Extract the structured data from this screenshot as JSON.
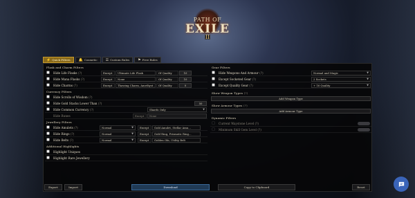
{
  "logo": {
    "line1": "PATH OF",
    "line2": "EXILE",
    "numeral": "II"
  },
  "tabs": [
    {
      "label": "Quick Filters",
      "icon": "lightning-icon"
    },
    {
      "label": "Cosmetic",
      "icon": "bell-icon"
    },
    {
      "label": "Custom Rules",
      "icon": "list-icon"
    },
    {
      "label": "Free Rules",
      "icon": "flag-icon"
    }
  ],
  "flask": {
    "title": "Flask and Charm Filters",
    "rows": [
      {
        "label": "Hide Life Flasks",
        "except": "Except",
        "value": "Ultimate Life Flask",
        "ql": "Of Quality",
        "num": "10"
      },
      {
        "label": "Hide Mana Flasks",
        "except": "Except",
        "value": "None",
        "ql": "Of Quality",
        "num": "10"
      },
      {
        "label": "Hide Charms",
        "except": "Except",
        "value": "Thawing Charm, Amethyst ...",
        "ql": "Of Quality",
        "num": "0"
      }
    ]
  },
  "currency": {
    "title": "Currency Filters",
    "rows": [
      {
        "label": "Hide Scrolls of Wisdom"
      },
      {
        "label": "Hide Gold Stacks Lower Than",
        "num": "50"
      },
      {
        "label": "Hide Common Currency",
        "select": "Shards Only"
      },
      {
        "label": "Hide Runes",
        "except": "Except",
        "value": "None"
      }
    ]
  },
  "jewellery": {
    "title": "Jewellery Filters",
    "rows": [
      {
        "label": "Hide Amulets",
        "select": "Normal",
        "except": "Except",
        "value": "Gold Amulet, Stellar Amu..."
      },
      {
        "label": "Hide Rings",
        "select": "Normal",
        "except": "Except",
        "value": "Gold Ring, Prismatic Ring..."
      },
      {
        "label": "Hide Belts",
        "select": "Normal",
        "except": "Except",
        "value": "Golden Obi, Utility Belt"
      }
    ]
  },
  "highlights": {
    "title": "Additional Highlights",
    "rows": [
      {
        "label": "Highlight Uniques"
      },
      {
        "label": "Highlight Rare Jewellery"
      }
    ]
  },
  "gear": {
    "title": "Gear Filters",
    "rows": [
      {
        "label": "Hide Weapons And Armour",
        "select": "Normal and Magic"
      },
      {
        "label": "Except Socketed Gear",
        "select": "2 Sockets"
      },
      {
        "label": "Except Quality Gear",
        "select": "+ 16 Quality"
      }
    ]
  },
  "weaponTypes": {
    "title": "Show Weapon Types",
    "button": "Add Weapon Type"
  },
  "armourTypes": {
    "title": "Show Armour Types",
    "button": "Add Armour Type"
  },
  "dynamic": {
    "title": "Dynamic Filters",
    "rows": [
      {
        "label": "Current Waystone Level"
      },
      {
        "label": "Minimum Skill Gem Level"
      }
    ]
  },
  "footer": {
    "export": "Export",
    "import": "Import",
    "download": "Download",
    "copy": "Copy to Clipboard",
    "reset": "Reset"
  },
  "colors": {
    "accent": "#8a6a1a",
    "download": "#203a55",
    "chat": "#3a64b8"
  }
}
